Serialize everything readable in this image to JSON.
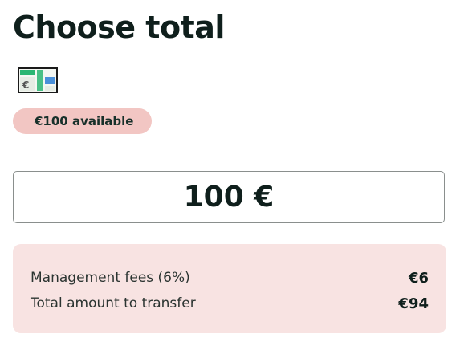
{
  "page": {
    "title": "Choose total"
  },
  "card": {
    "icon": "gift-card-icon",
    "colors": {
      "green": "#2bb673",
      "blue": "#4a90d9",
      "light": "#e8f0e6"
    }
  },
  "balance": {
    "badge_text": "€100 available",
    "color": "#f2c6c3"
  },
  "amount_input": {
    "value": "100 €"
  },
  "fees": {
    "rows": [
      {
        "label": "Management fees (6%)",
        "value": "€6"
      },
      {
        "label": "Total amount to transfer",
        "value": "€94"
      }
    ],
    "color": "#f8e3e2"
  }
}
